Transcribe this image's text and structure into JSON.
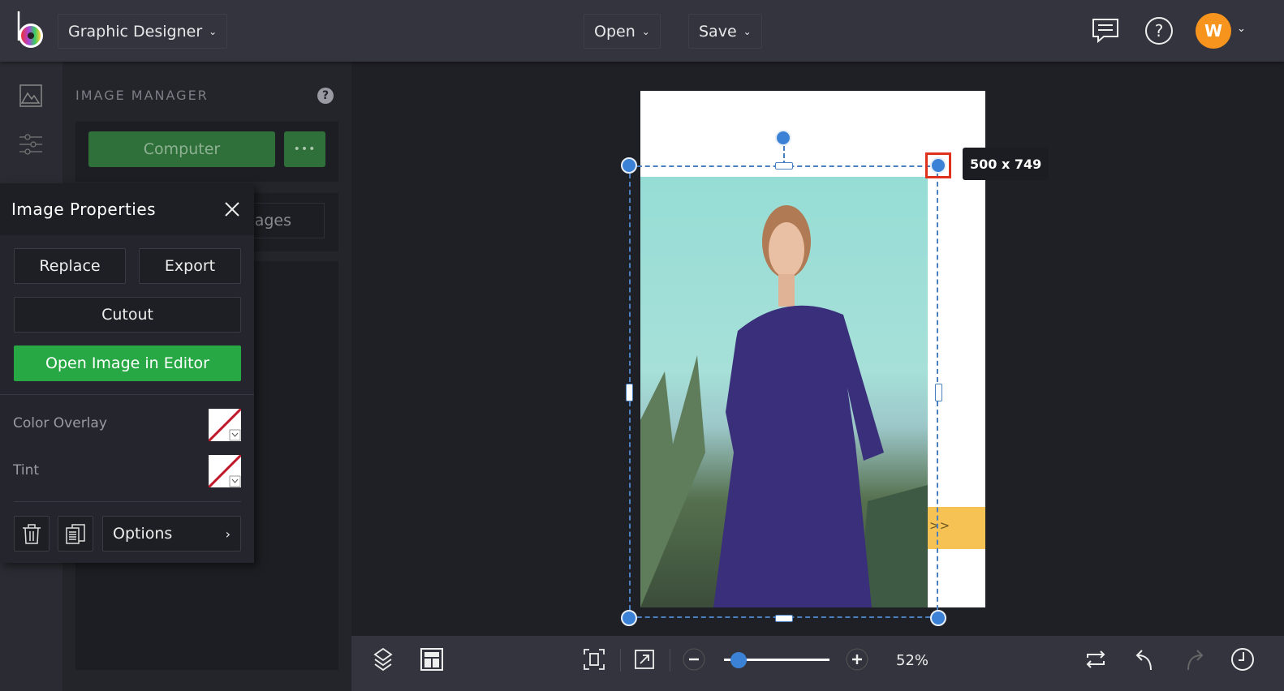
{
  "header": {
    "workspace_label": "Graphic Designer",
    "open_label": "Open",
    "save_label": "Save",
    "avatar_initial": "W"
  },
  "image_manager": {
    "title": "IMAGE MANAGER",
    "computer_label": "Computer",
    "more_label": "•••",
    "images_label_partial": "ages"
  },
  "image_properties": {
    "title": "Image Properties",
    "replace_label": "Replace",
    "export_label": "Export",
    "cutout_label": "Cutout",
    "open_editor_label": "Open Image in Editor",
    "color_overlay_label": "Color Overlay",
    "tint_label": "Tint",
    "options_label": "Options"
  },
  "canvas": {
    "size_tooltip": "500 x 749",
    "banner_text": ">>"
  },
  "bottom_bar": {
    "zoom_value": "52%",
    "zoom_fraction": 0.1
  },
  "colors": {
    "accent": "#3b82d6",
    "green": "#27a844",
    "avatar": "#f7941d",
    "banner": "#f6c253"
  }
}
